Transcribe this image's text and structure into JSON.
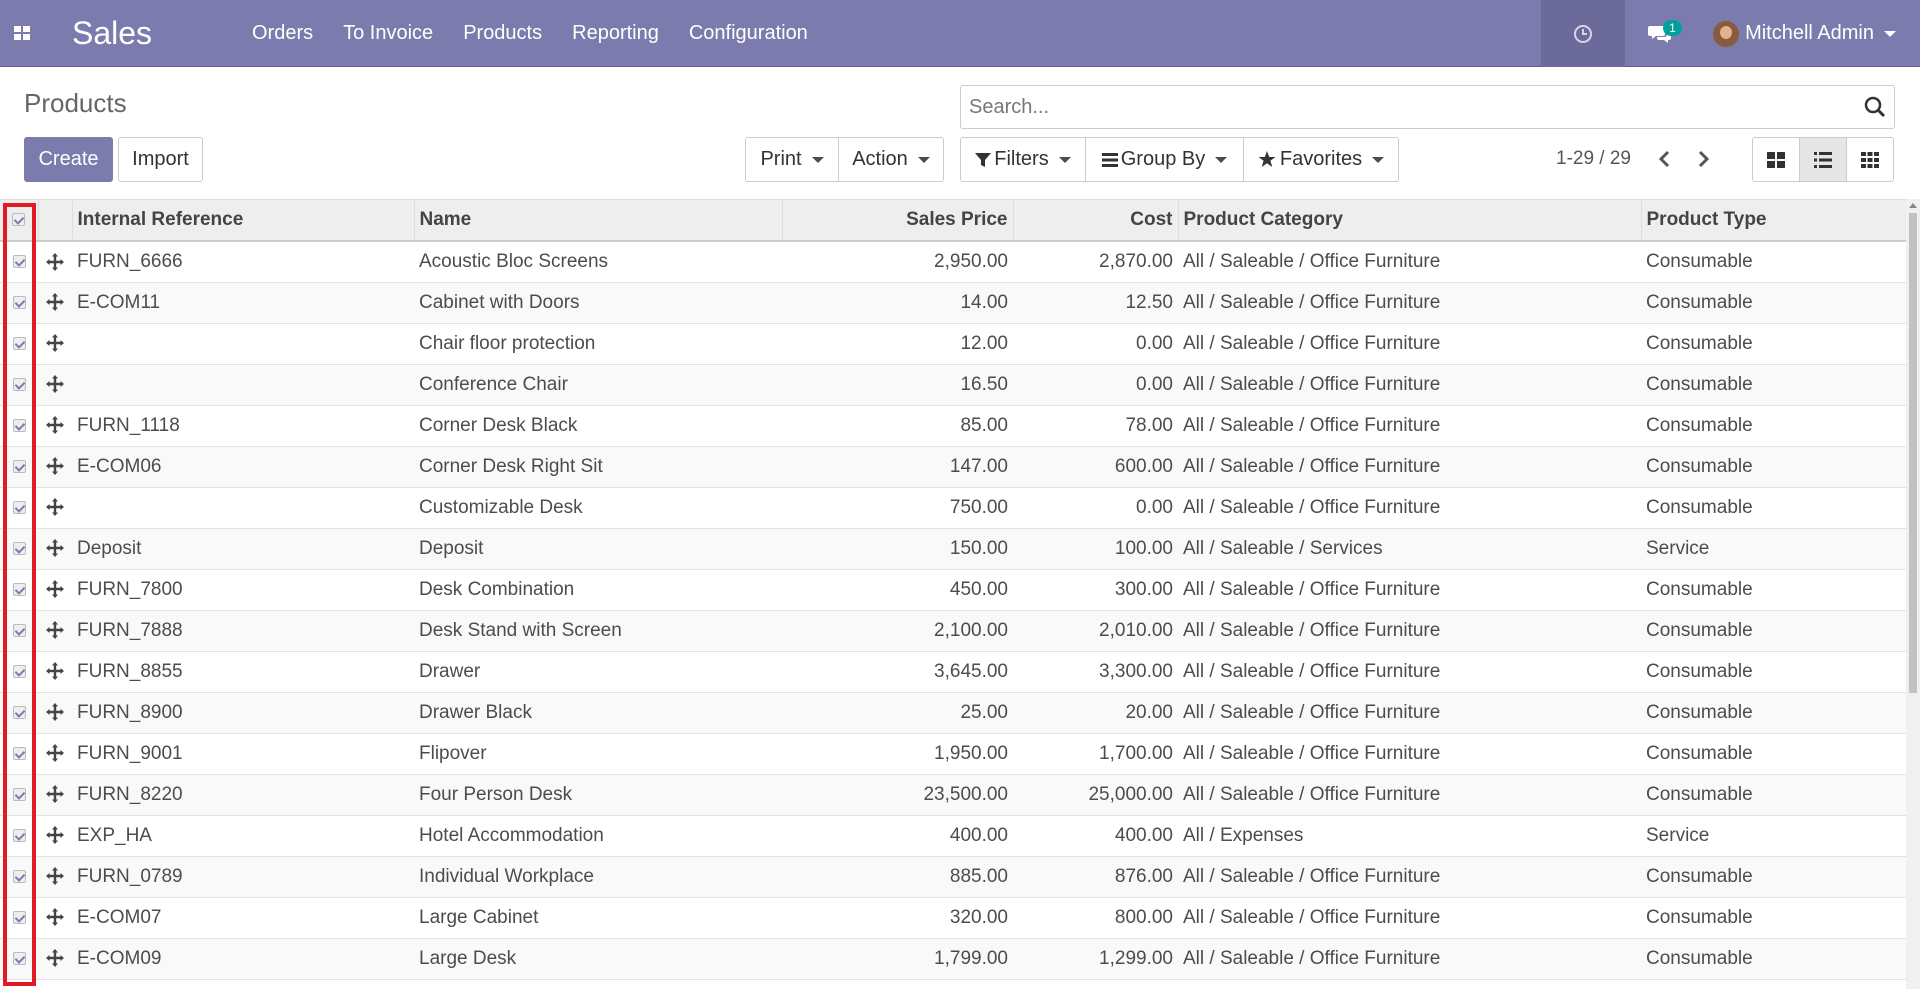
{
  "navbar": {
    "app_name": "Sales",
    "menu": [
      "Orders",
      "To Invoice",
      "Products",
      "Reporting",
      "Configuration"
    ],
    "chat_count": "1",
    "user_name": "Mitchell Admin",
    "bg_color": "#7c7bad"
  },
  "control_panel": {
    "title": "Products",
    "search_placeholder": "Search...",
    "create_label": "Create",
    "import_label": "Import",
    "print_label": "Print",
    "action_label": "Action",
    "filters_label": "Filters",
    "group_by_label": "Group By",
    "favorites_label": "Favorites",
    "pager": "1-29 / 29"
  },
  "table": {
    "columns": [
      "Internal Reference",
      "Name",
      "Sales Price",
      "Cost",
      "Product Category",
      "Product Type"
    ],
    "rows": [
      [
        "FURN_6666",
        "Acoustic Bloc Screens",
        "2,950.00",
        "2,870.00",
        "All / Saleable / Office Furniture",
        "Consumable"
      ],
      [
        "E-COM11",
        "Cabinet with Doors",
        "14.00",
        "12.50",
        "All / Saleable / Office Furniture",
        "Consumable"
      ],
      [
        "",
        "Chair floor protection",
        "12.00",
        "0.00",
        "All / Saleable / Office Furniture",
        "Consumable"
      ],
      [
        "",
        "Conference Chair",
        "16.50",
        "0.00",
        "All / Saleable / Office Furniture",
        "Consumable"
      ],
      [
        "FURN_1118",
        "Corner Desk Black",
        "85.00",
        "78.00",
        "All / Saleable / Office Furniture",
        "Consumable"
      ],
      [
        "E-COM06",
        "Corner Desk Right Sit",
        "147.00",
        "600.00",
        "All / Saleable / Office Furniture",
        "Consumable"
      ],
      [
        "",
        "Customizable Desk",
        "750.00",
        "0.00",
        "All / Saleable / Office Furniture",
        "Consumable"
      ],
      [
        "Deposit",
        "Deposit",
        "150.00",
        "100.00",
        "All / Saleable / Services",
        "Service"
      ],
      [
        "FURN_7800",
        "Desk Combination",
        "450.00",
        "300.00",
        "All / Saleable / Office Furniture",
        "Consumable"
      ],
      [
        "FURN_7888",
        "Desk Stand with Screen",
        "2,100.00",
        "2,010.00",
        "All / Saleable / Office Furniture",
        "Consumable"
      ],
      [
        "FURN_8855",
        "Drawer",
        "3,645.00",
        "3,300.00",
        "All / Saleable / Office Furniture",
        "Consumable"
      ],
      [
        "FURN_8900",
        "Drawer Black",
        "25.00",
        "20.00",
        "All / Saleable / Office Furniture",
        "Consumable"
      ],
      [
        "FURN_9001",
        "Flipover",
        "1,950.00",
        "1,700.00",
        "All / Saleable / Office Furniture",
        "Consumable"
      ],
      [
        "FURN_8220",
        "Four Person Desk",
        "23,500.00",
        "25,000.00",
        "All / Saleable / Office Furniture",
        "Consumable"
      ],
      [
        "EXP_HA",
        "Hotel Accommodation",
        "400.00",
        "400.00",
        "All / Expenses",
        "Service"
      ],
      [
        "FURN_0789",
        "Individual Workplace",
        "885.00",
        "876.00",
        "All / Saleable / Office Furniture",
        "Consumable"
      ],
      [
        "E-COM07",
        "Large Cabinet",
        "320.00",
        "800.00",
        "All / Saleable / Office Furniture",
        "Consumable"
      ],
      [
        "E-COM09",
        "Large Desk",
        "1,799.00",
        "1,299.00",
        "All / Saleable / Office Furniture",
        "Consumable"
      ]
    ]
  }
}
